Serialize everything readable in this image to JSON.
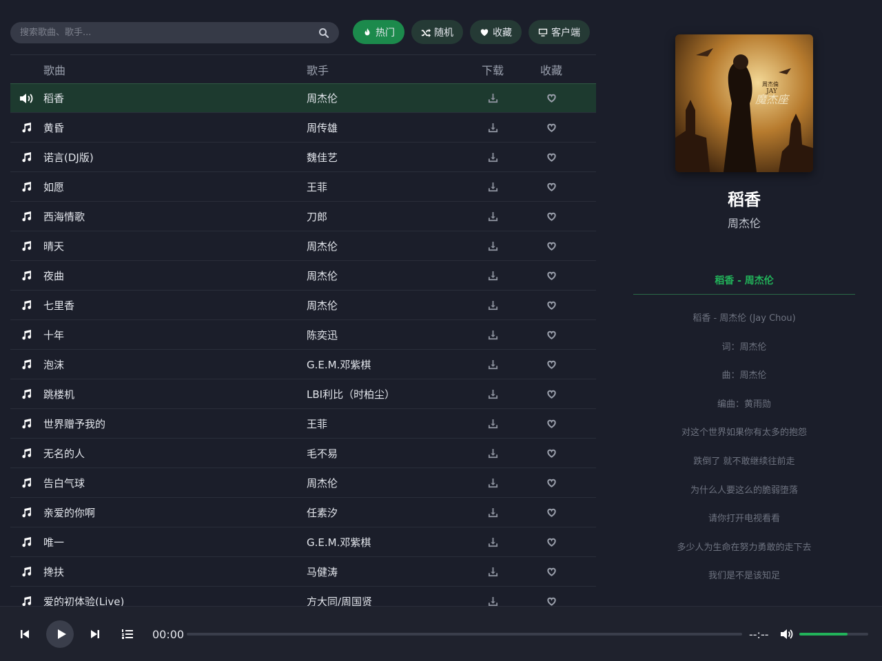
{
  "search": {
    "placeholder": "搜索歌曲、歌手..."
  },
  "toolbar": [
    {
      "label": "热门",
      "icon": "fire-icon",
      "active": true
    },
    {
      "label": "随机",
      "icon": "shuffle-icon",
      "active": false
    },
    {
      "label": "收藏",
      "icon": "heart-icon",
      "active": false
    },
    {
      "label": "客户端",
      "icon": "desktop-icon",
      "active": false
    }
  ],
  "table": {
    "headers": {
      "song": "歌曲",
      "artist": "歌手",
      "download": "下载",
      "favorite": "收藏"
    },
    "rows": [
      {
        "song": "稻香",
        "artist": "周杰伦",
        "playing": true
      },
      {
        "song": "黄昏",
        "artist": "周传雄"
      },
      {
        "song": "诺言(DJ版)",
        "artist": "魏佳艺"
      },
      {
        "song": "如愿",
        "artist": "王菲"
      },
      {
        "song": "西海情歌",
        "artist": "刀郎"
      },
      {
        "song": "晴天",
        "artist": "周杰伦"
      },
      {
        "song": "夜曲",
        "artist": "周杰伦"
      },
      {
        "song": "七里香",
        "artist": "周杰伦"
      },
      {
        "song": "十年",
        "artist": "陈奕迅"
      },
      {
        "song": "泡沫",
        "artist": "G.E.M.邓紫棋"
      },
      {
        "song": "跳楼机",
        "artist": "LBI利比（时柏尘）"
      },
      {
        "song": "世界赠予我的",
        "artist": "王菲"
      },
      {
        "song": "无名的人",
        "artist": "毛不易"
      },
      {
        "song": "告白气球",
        "artist": "周杰伦"
      },
      {
        "song": "亲爱的你啊",
        "artist": "任素汐"
      },
      {
        "song": "唯一",
        "artist": "G.E.M.邓紫棋"
      },
      {
        "song": "搀扶",
        "artist": "马健涛"
      },
      {
        "song": "爱的初体验(Live)",
        "artist": "方大同/周国贤"
      }
    ]
  },
  "now_playing": {
    "title": "稻香",
    "artist": "周杰伦",
    "cover_text": "周杰倫 JAY 魔杰座"
  },
  "lyrics": {
    "heading": "稻香 - 周杰伦",
    "lines": [
      "稻香 - 周杰伦 (Jay Chou)",
      "词：周杰伦",
      "曲：周杰伦",
      "编曲：黄雨勋",
      "对这个世界如果你有太多的抱怨",
      "跌倒了 就不敢继续往前走",
      "为什么人要这么的脆弱堕落",
      "请你打开电视看看",
      "多少人为生命在努力勇敢的走下去",
      "我们是不是该知足"
    ]
  },
  "player": {
    "current_time": "00:00",
    "total_time": "--:--",
    "progress": 0,
    "volume": 0.7
  },
  "colors": {
    "accent": "#22b35a",
    "playing_row": "#1d3a2f",
    "background": "#1b1e2a"
  }
}
